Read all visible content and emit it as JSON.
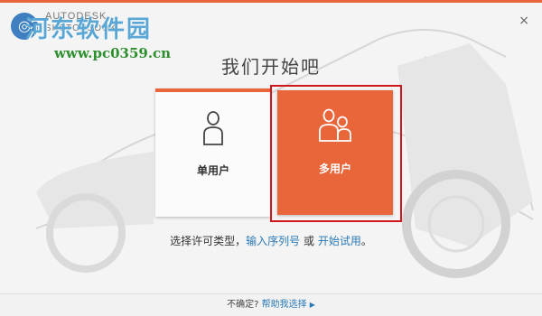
{
  "brand": {
    "line1": "AUTODESK",
    "line2": "SKETCHBOOK"
  },
  "watermark": {
    "site": "河东软件园",
    "url": "www.pc0359.cn",
    "badge": "◎"
  },
  "window": {
    "close_glyph": "×"
  },
  "title": "我们开始吧",
  "options": [
    {
      "label": "单用户",
      "icon": "single-user-icon"
    },
    {
      "label": "多用户",
      "icon": "multi-user-icon"
    }
  ],
  "hint": {
    "prefix": "选择许可类型，",
    "serial_link": "输入序列号",
    "or": " 或 ",
    "trial_link": "开始试用",
    "suffix": "。"
  },
  "footer": {
    "question": "不确定? ",
    "help_link": "帮助我选择",
    "arrow": "▶"
  },
  "colors": {
    "accent": "#e8663a",
    "selection": "#d0181b",
    "link": "#2a7ab8"
  }
}
